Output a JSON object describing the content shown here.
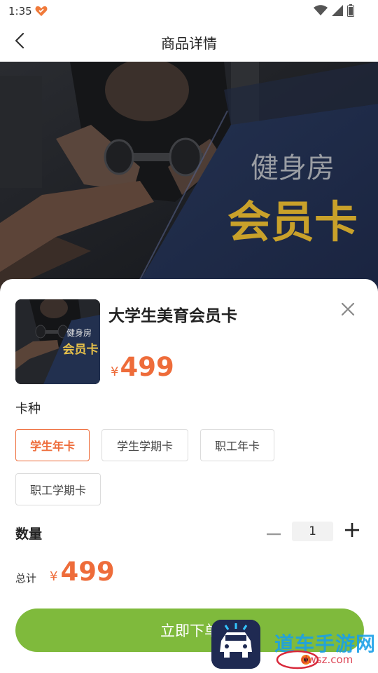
{
  "status_bar": {
    "time": "1:35"
  },
  "nav": {
    "title": "商品详情"
  },
  "hero": {
    "line1": "健身房",
    "line2": "会员卡"
  },
  "product": {
    "name": "大学生美育会员卡",
    "thumb_line1": "健身房",
    "thumb_line2": "会员卡",
    "currency": "¥",
    "price": "499"
  },
  "card_type": {
    "label": "卡种",
    "options": [
      {
        "label": "学生年卡",
        "selected": true
      },
      {
        "label": "学生学期卡",
        "selected": false
      },
      {
        "label": "职工年卡",
        "selected": false
      },
      {
        "label": "职工学期卡",
        "selected": false
      }
    ]
  },
  "quantity": {
    "label": "数量",
    "value": "1"
  },
  "total": {
    "label": "总计",
    "currency": "¥",
    "amount": "499"
  },
  "submit": {
    "label": "立即下单"
  },
  "watermark": {
    "text": "道车手游网",
    "url": "dwsz.com"
  },
  "colors": {
    "accent": "#ee6c3a",
    "button": "#7fba3c",
    "hero_gold": "#c9a12a"
  },
  "icons": {
    "back": "chevron-left-icon",
    "close": "close-icon",
    "minus": "minus-icon",
    "plus": "plus-icon",
    "wifi": "wifi-icon",
    "signal": "signal-icon",
    "battery": "battery-icon",
    "heart": "heart-icon"
  }
}
